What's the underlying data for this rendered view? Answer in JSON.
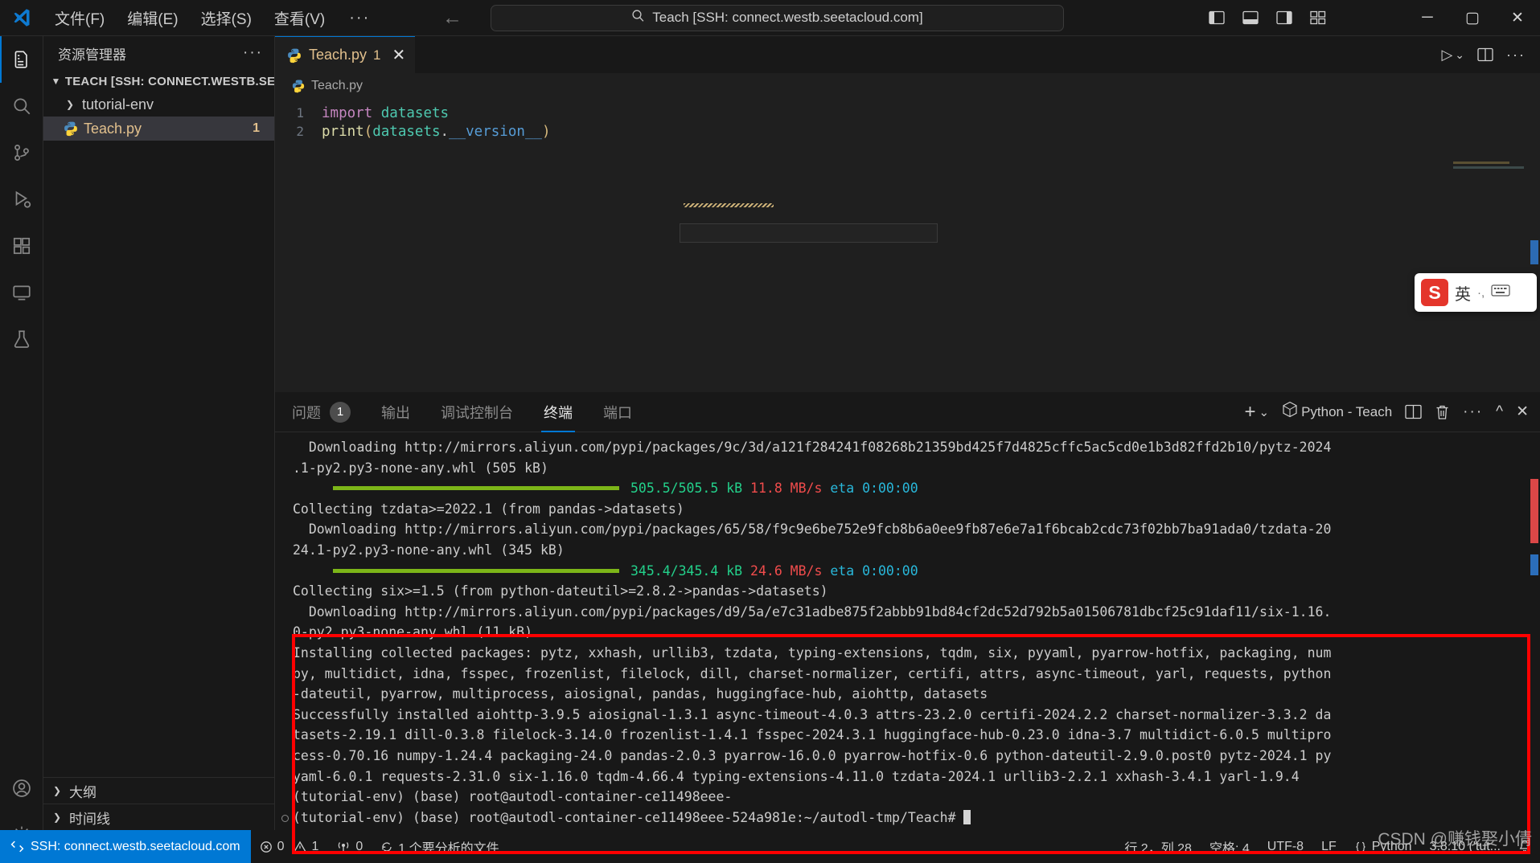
{
  "titlebar": {
    "menu": [
      "文件(F)",
      "编辑(E)",
      "选择(S)",
      "查看(V)"
    ],
    "menu_more": "···",
    "back_icon": "←",
    "forward_icon": "→",
    "search_icon": "search-icon",
    "command_center_text": "Teach [SSH: connect.westb.seetacloud.com]",
    "minimize": "─",
    "maximize": "▢",
    "close": "✕"
  },
  "activitybar": {
    "items": [
      {
        "name": "explorer",
        "icon": "files-icon",
        "active": true
      },
      {
        "name": "search",
        "icon": "search-icon",
        "active": false
      },
      {
        "name": "source-control",
        "icon": "source-control-icon",
        "active": false
      },
      {
        "name": "run-debug",
        "icon": "run-debug-icon",
        "active": false
      },
      {
        "name": "extensions",
        "icon": "extensions-icon",
        "active": false
      },
      {
        "name": "remote-explorer",
        "icon": "remote-explorer-icon",
        "active": false
      },
      {
        "name": "testing",
        "icon": "beaker-icon",
        "active": false
      }
    ],
    "bottom": [
      {
        "name": "accounts",
        "icon": "account-icon"
      },
      {
        "name": "settings",
        "icon": "gear-icon"
      }
    ]
  },
  "sidebar": {
    "title": "资源管理器",
    "more_icon": "···",
    "root_label": "TEACH [SSH: CONNECT.WESTB.SEETAC...",
    "items": [
      {
        "label": "tutorial-env",
        "type": "folder",
        "expanded": false,
        "badge": "",
        "selected": false
      },
      {
        "label": "Teach.py",
        "type": "python-file",
        "expanded": false,
        "badge": "1",
        "selected": true
      }
    ],
    "sections": [
      {
        "label": "大纲"
      },
      {
        "label": "时间线"
      }
    ]
  },
  "editor": {
    "tab": {
      "filename": "Teach.py",
      "badge": "1",
      "close_icon": "✕",
      "icon": "python-icon"
    },
    "tab_actions": {
      "run_icon": "▷",
      "run_chevron": "⌄",
      "split_icon": "split-editor-icon",
      "more_icon": "···"
    },
    "breadcrumb": "Teach.py",
    "lines": [
      {
        "number": "1",
        "tokens": [
          {
            "text": "import ",
            "cls": "k-kw"
          },
          {
            "text": "datasets",
            "cls": "k-mod"
          }
        ]
      },
      {
        "number": "2",
        "tokens": [
          {
            "text": "print",
            "cls": "k-fn"
          },
          {
            "text": "(",
            "cls": "k-paren"
          },
          {
            "text": "datasets",
            "cls": "k-mod"
          },
          {
            "text": ".",
            "cls": "k-def"
          },
          {
            "text": "__version__",
            "cls": "k-attr"
          },
          {
            "text": ")",
            "cls": "k-paren"
          }
        ]
      }
    ]
  },
  "panel": {
    "tabs": [
      {
        "label": "问题",
        "badge": "1",
        "active": false
      },
      {
        "label": "输出",
        "badge": "",
        "active": false
      },
      {
        "label": "调试控制台",
        "badge": "",
        "active": false
      },
      {
        "label": "终端",
        "badge": "",
        "active": true
      },
      {
        "label": "端口",
        "badge": "",
        "active": false
      }
    ],
    "actions": {
      "new_terminal": "+",
      "new_terminal_chevron": "⌄",
      "terminal_name": "Python - Teach",
      "terminal_icon": "cube-icon",
      "split_icon": "split-terminal-icon",
      "kill_icon": "trash-icon",
      "more_icon": "···",
      "maximize_icon": "^",
      "close_icon": "✕"
    }
  },
  "terminal": {
    "lines": [
      {
        "type": "text",
        "text": "  Downloading http://mirrors.aliyun.com/pypi/packages/9c/3d/a121f284241f08268b21359bd425f7d4825cffc5ac5cd0e1b3d82ffd2b10/pytz-2024"
      },
      {
        "type": "text",
        "text": ".1-py2.py3-none-any.whl (505 kB)"
      },
      {
        "type": "progress",
        "size": "505.5/505.5 kB",
        "speed": "11.8 MB/s",
        "eta": "eta 0:00:00"
      },
      {
        "type": "text",
        "text": "Collecting tzdata>=2022.1 (from pandas->datasets)"
      },
      {
        "type": "text",
        "text": "  Downloading http://mirrors.aliyun.com/pypi/packages/65/58/f9c9e6be752e9fcb8b6a0ee9fb87e6e7a1f6bcab2cdc73f02bb7ba91ada0/tzdata-20"
      },
      {
        "type": "text",
        "text": "24.1-py2.py3-none-any.whl (345 kB)"
      },
      {
        "type": "progress",
        "size": "345.4/345.4 kB",
        "speed": "24.6 MB/s",
        "eta": "eta 0:00:00"
      },
      {
        "type": "text",
        "text": "Collecting six>=1.5 (from python-dateutil>=2.8.2->pandas->datasets)"
      },
      {
        "type": "text",
        "text": "  Downloading http://mirrors.aliyun.com/pypi/packages/d9/5a/e7c31adbe875f2abbb91bd84cf2dc52d792b5a01506781dbcf25c91daf11/six-1.16."
      },
      {
        "type": "text",
        "text": "0-py2.py3-none-any.whl (11 kB)"
      },
      {
        "type": "text",
        "text": "Installing collected packages: pytz, xxhash, urllib3, tzdata, typing-extensions, tqdm, six, pyyaml, pyarrow-hotfix, packaging, num"
      },
      {
        "type": "text",
        "text": "py, multidict, idna, fsspec, frozenlist, filelock, dill, charset-normalizer, certifi, attrs, async-timeout, yarl, requests, python"
      },
      {
        "type": "text",
        "text": "-dateutil, pyarrow, multiprocess, aiosignal, pandas, huggingface-hub, aiohttp, datasets"
      },
      {
        "type": "text",
        "text": "Successfully installed aiohttp-3.9.5 aiosignal-1.3.1 async-timeout-4.0.3 attrs-23.2.0 certifi-2024.2.2 charset-normalizer-3.3.2 da"
      },
      {
        "type": "text",
        "text": "tasets-2.19.1 dill-0.3.8 filelock-3.14.0 frozenlist-1.4.1 fsspec-2024.3.1 huggingface-hub-0.23.0 idna-3.7 multidict-6.0.5 multipro"
      },
      {
        "type": "text",
        "text": "cess-0.70.16 numpy-1.24.4 packaging-24.0 pandas-2.0.3 pyarrow-16.0.0 pyarrow-hotfix-0.6 python-dateutil-2.9.0.post0 pytz-2024.1 py"
      },
      {
        "type": "text",
        "text": "yaml-6.0.1 requests-2.31.0 six-1.16.0 tqdm-4.66.4 typing-extensions-4.11.0 tzdata-2024.1 urllib3-2.2.1 xxhash-3.4.1 yarl-1.9.4"
      },
      {
        "type": "text",
        "text": "(tutorial-env) (base) root@autodl-container-ce11498eee-"
      },
      {
        "type": "prompt",
        "text": "(tutorial-env) (base) root@autodl-container-ce11498eee-524a981e:~/autodl-tmp/Teach# "
      }
    ]
  },
  "ime": {
    "logo_text": "S",
    "mode": "英",
    "dots": "·,",
    "keyboard_icon": "keyboard-icon"
  },
  "statusbar": {
    "remote_icon": "remote-icon",
    "remote_label": "SSH: connect.westb.seetacloud.com",
    "errors_icon": "error-icon",
    "errors": "0",
    "warnings_icon": "warning-icon",
    "warnings": "1",
    "radio_icon": "radio-tower-icon",
    "ports": "0",
    "sync_icon": "sync-icon",
    "analyze_label": "1 个要分析的文件",
    "cursor_position": "行 2，列 28",
    "indentation": "空格: 4",
    "encoding": "UTF-8",
    "eol": "LF",
    "lang_icon": "braces-icon",
    "language": "Python",
    "interpreter": "3.8.10 ('tut...",
    "bell_icon": "bell-icon"
  },
  "annotation": {
    "box_color": "#ff0000"
  },
  "watermark": "CSDN @赚钱娶小倩",
  "colors": {
    "accent": "#0078d4",
    "bg": "#1e1e1e",
    "panel_bg": "#181818",
    "editor_bg": "#1f1f1f",
    "modified_file": "#e2c08d",
    "terminal_green": "#23d18b",
    "terminal_red": "#f14c4c",
    "terminal_cyan": "#29b8db",
    "progress_bar": "#7cb518"
  }
}
